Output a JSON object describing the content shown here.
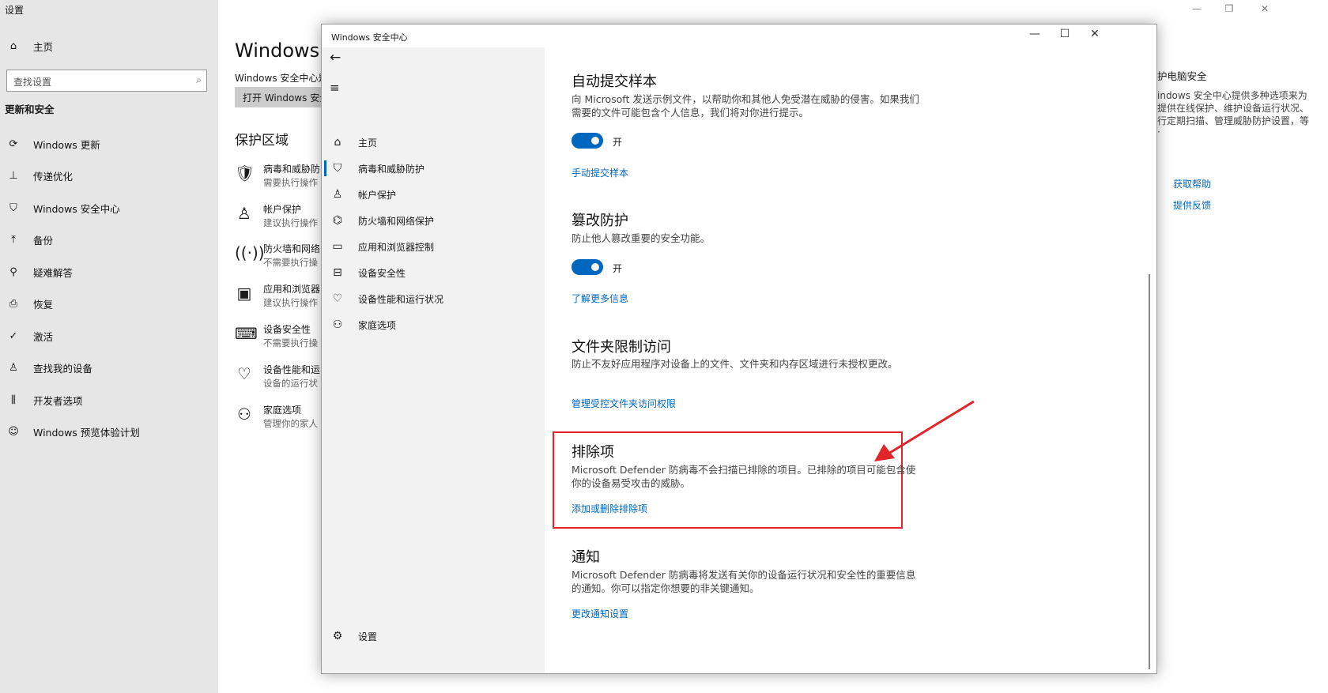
{
  "settings": {
    "window_title": "设置",
    "nav": {
      "home": "主页",
      "search_placeholder": "查找设置",
      "section": "更新和安全",
      "items": [
        "Windows 更新",
        "传递优化",
        "Windows 安全中心",
        "备份",
        "疑难解答",
        "恢复",
        "激活",
        "查找我的设备",
        "开发者选项",
        "Windows 预览体验计划"
      ]
    },
    "main": {
      "title": "Windows 安",
      "subtitle": "Windows 安全中心是",
      "open_button": "打开 Windows 安全",
      "zones_title": "保护区域",
      "zones": [
        {
          "title": "病毒和威胁防",
          "sub": "需要执行操作"
        },
        {
          "title": "帐户保护",
          "sub": "建议执行操作"
        },
        {
          "title": "防火墙和网络",
          "sub": "不需要执行操"
        },
        {
          "title": "应用和浏览器",
          "sub": "建议执行操作"
        },
        {
          "title": "设备安全性",
          "sub": "不需要执行操"
        },
        {
          "title": "设备性能和运",
          "sub": "设备的运行状"
        },
        {
          "title": "家庭选项",
          "sub": "管理你的家人"
        }
      ]
    },
    "right": {
      "heading": "护电脑安全",
      "lines": [
        "indows 安全中心提供多种选项来为",
        "提供在线保护、维护设备运行状况、",
        "行定期扫描、管理威胁防护设置，等"
      ],
      "get_help": "获取帮助",
      "feedback": "提供反馈"
    }
  },
  "security": {
    "window_title": "Windows 安全中心",
    "nav": {
      "items": [
        "主页",
        "病毒和威胁防护",
        "帐户保护",
        "防火墙和网络保护",
        "应用和浏览器控制",
        "设备安全性",
        "设备性能和运行状况",
        "家庭选项"
      ],
      "selected": 1,
      "settings": "设置"
    },
    "sections": {
      "sample": {
        "title": "自动提交样本",
        "desc": "向 Microsoft 发送示例文件，以帮助你和其他人免受潜在威胁的侵害。如果我们需要的文件可能包含个人信息，我们将对你进行提示。",
        "toggle_label": "开",
        "link": "手动提交样本"
      },
      "tamper": {
        "title": "篡改防护",
        "desc": "防止他人篡改重要的安全功能。",
        "toggle_label": "开",
        "link": "了解更多信息"
      },
      "folder": {
        "title": "文件夹限制访问",
        "desc": "防止不友好应用程序对设备上的文件、文件夹和内存区域进行未授权更改。",
        "link": "管理受控文件夹访问权限"
      },
      "exclusions": {
        "title": "排除项",
        "desc": "Microsoft Defender 防病毒不会扫描已排除的项目。已排除的项目可能包含使你的设备易受攻击的威胁。",
        "link": "添加或删除排除项"
      },
      "notify": {
        "title": "通知",
        "desc": "Microsoft Defender 防病毒将发送有关你的设备运行状况和安全性的重要信息的通知。你可以指定你想要的非关键通知。",
        "link": "更改通知设置"
      }
    }
  },
  "colors": {
    "accent": "#0067c0",
    "highlight_box": "#e0242a",
    "arrow": "#e0242a"
  }
}
